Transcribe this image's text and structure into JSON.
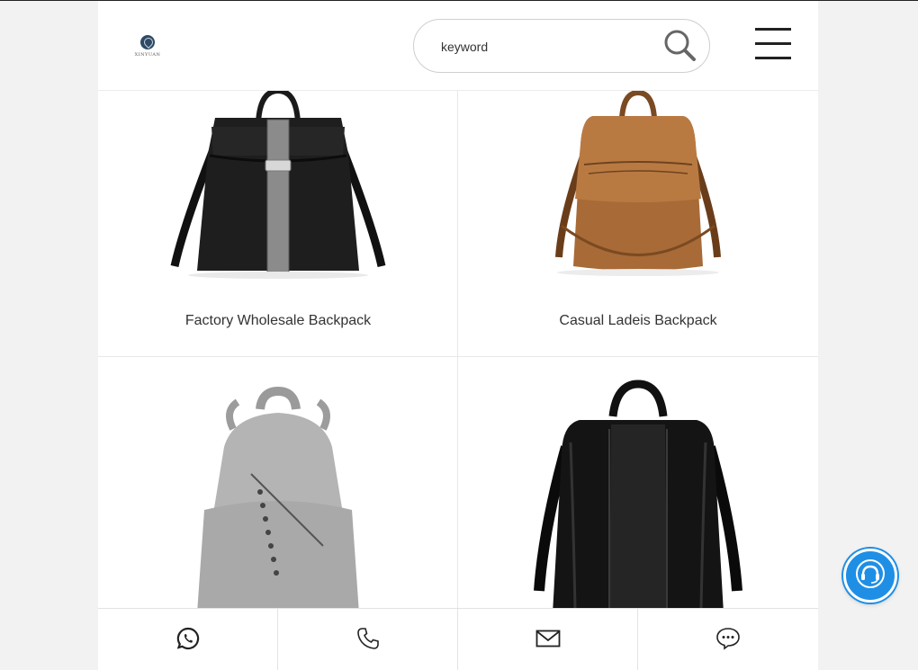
{
  "header": {
    "logo_text": "XINYUAN",
    "search": {
      "placeholder": "keyword"
    }
  },
  "products": [
    {
      "name": "Factory Wholesale Backpack"
    },
    {
      "name": "Casual Ladeis Backpack"
    },
    {
      "name": ""
    },
    {
      "name": ""
    }
  ],
  "bottom_bar": [
    {
      "icon": "whatsapp-icon"
    },
    {
      "icon": "phone-icon"
    },
    {
      "icon": "mail-icon"
    },
    {
      "icon": "chat-icon"
    }
  ],
  "support_button": {
    "icon": "headset-icon",
    "color": "#1f8fe6"
  }
}
